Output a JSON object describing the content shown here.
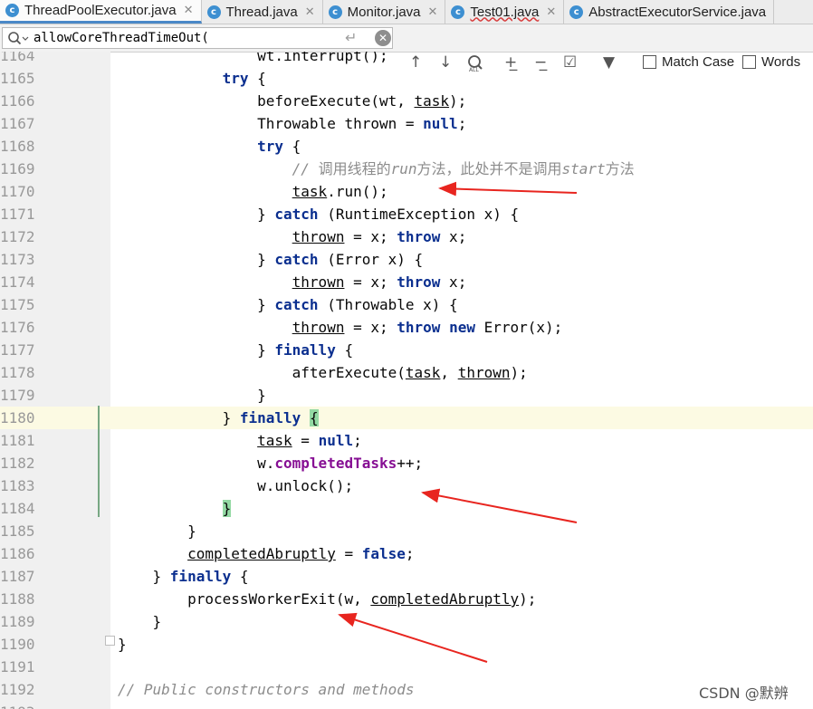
{
  "tabs": [
    {
      "label": "ThreadPoolExecutor.java",
      "active": true
    },
    {
      "label": "Thread.java"
    },
    {
      "label": "Monitor.java"
    },
    {
      "label": "Test01.java"
    },
    {
      "label": "AbstractExecutorService.java"
    }
  ],
  "search": {
    "value": "allowCoreThreadTimeOut(",
    "match_case_label": "Match Case",
    "words_label": "Words"
  },
  "lines": [
    {
      "n": "1164",
      "text": "                wt.interrupt();"
    },
    {
      "n": "1165",
      "text": "            try {"
    },
    {
      "n": "1166",
      "text": "                beforeExecute(wt, task);"
    },
    {
      "n": "1167",
      "text": "                Throwable thrown = null;"
    },
    {
      "n": "1168",
      "text": "                try {"
    },
    {
      "n": "1169",
      "text": "                    // 调用线程的run方法，此处并不是调用start方法"
    },
    {
      "n": "1170",
      "text": "                    task.run();"
    },
    {
      "n": "1171",
      "text": "                } catch (RuntimeException x) {"
    },
    {
      "n": "1172",
      "text": "                    thrown = x; throw x;"
    },
    {
      "n": "1173",
      "text": "                } catch (Error x) {"
    },
    {
      "n": "1174",
      "text": "                    thrown = x; throw x;"
    },
    {
      "n": "1175",
      "text": "                } catch (Throwable x) {"
    },
    {
      "n": "1176",
      "text": "                    thrown = x; throw new Error(x);"
    },
    {
      "n": "1177",
      "text": "                } finally {"
    },
    {
      "n": "1178",
      "text": "                    afterExecute(task, thrown);"
    },
    {
      "n": "1179",
      "text": "                }"
    },
    {
      "n": "1180",
      "text": "            } finally {"
    },
    {
      "n": "1181",
      "text": "                task = null;"
    },
    {
      "n": "1182",
      "text": "                w.completedTasks++;"
    },
    {
      "n": "1183",
      "text": "                w.unlock();"
    },
    {
      "n": "1184",
      "text": "            }"
    },
    {
      "n": "1185",
      "text": "        }"
    },
    {
      "n": "1186",
      "text": "        completedAbruptly = false;"
    },
    {
      "n": "1187",
      "text": "    } finally {"
    },
    {
      "n": "1188",
      "text": "        processWorkerExit(w, completedAbruptly);"
    },
    {
      "n": "1189",
      "text": "    }"
    },
    {
      "n": "1190",
      "text": "}"
    },
    {
      "n": "1191",
      "text": ""
    },
    {
      "n": "1192",
      "text": "// Public constructors and methods"
    },
    {
      "n": "1193",
      "text": ""
    }
  ],
  "watermark": "CSDN @默辨",
  "colors": {
    "keyword": "#0b2f8f",
    "field": "#871094",
    "comment": "#8c8c8c",
    "arrow": "#e8251f",
    "caret_line": "#fcfae3",
    "brace_match": "#93d9a3"
  }
}
